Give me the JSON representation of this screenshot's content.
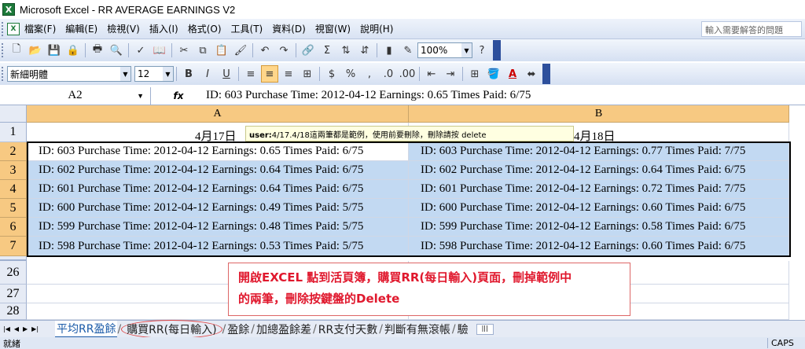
{
  "window": {
    "title": "Microsoft Excel - RR AVERAGE EARNINGS V2",
    "icon": "excel-icon"
  },
  "menu": {
    "items": [
      "檔案(F)",
      "編輯(E)",
      "檢視(V)",
      "插入(I)",
      "格式(O)",
      "工具(T)",
      "資料(D)",
      "視窗(W)",
      "說明(H)"
    ],
    "help_placeholder": "輸入需要解答的問題"
  },
  "toolbar": {
    "zoom": "100%",
    "font_name": "新細明體",
    "font_size": "12",
    "bold": "B",
    "italic": "I",
    "underline": "U",
    "currency": "$",
    "percent": "%"
  },
  "formula_bar": {
    "name_box": "A2",
    "fx": "fx",
    "formula": "ID: 603 Purchase Time: 2012-04-12 Earnings: 0.65 Times Paid: 6/75"
  },
  "sheet": {
    "columns": [
      "A",
      "B"
    ],
    "row_headers": [
      "1",
      "2",
      "3",
      "4",
      "5",
      "6",
      "7",
      "26",
      "27",
      "28"
    ],
    "header_row": {
      "a": "4月17日",
      "b": "4月18日"
    },
    "comment": {
      "author": "user:",
      "text": "4/17.4/18這兩筆都是範例，使用前要刪除，刪除請按 delete"
    },
    "rows": [
      {
        "a": "ID: 603 Purchase Time: 2012-04-12 Earnings: 0.65 Times Paid: 6/75",
        "b": "ID: 603 Purchase Time: 2012-04-12 Earnings: 0.77 Times Paid: 7/75"
      },
      {
        "a": "ID: 602 Purchase Time: 2012-04-12 Earnings: 0.64 Times Paid: 6/75",
        "b": "ID: 602 Purchase Time: 2012-04-12 Earnings: 0.64 Times Paid: 6/75"
      },
      {
        "a": "ID: 601 Purchase Time: 2012-04-12 Earnings: 0.64 Times Paid: 6/75",
        "b": "ID: 601 Purchase Time: 2012-04-12 Earnings: 0.72 Times Paid: 7/75"
      },
      {
        "a": "ID: 600 Purchase Time: 2012-04-12 Earnings: 0.49 Times Paid: 5/75",
        "b": "ID: 600 Purchase Time: 2012-04-12 Earnings: 0.60 Times Paid: 6/75"
      },
      {
        "a": "ID: 599 Purchase Time: 2012-04-12 Earnings: 0.48 Times Paid: 5/75",
        "b": "ID: 599 Purchase Time: 2012-04-12 Earnings: 0.58 Times Paid: 6/75"
      },
      {
        "a": "ID: 598 Purchase Time: 2012-04-12 Earnings: 0.53 Times Paid: 5/75",
        "b": "ID: 598 Purchase Time: 2012-04-12 Earnings: 0.60 Times Paid: 6/75"
      }
    ]
  },
  "annotation": {
    "line1": "開啟EXCEL 點到活頁簿，購買RR(每日輸入)頁面，刪掉範例中",
    "line2": "的兩筆，刪除按鍵盤的Delete"
  },
  "tabs": [
    "平均RR盈餘",
    "購買RR(每日輸入)",
    "盈餘",
    "加總盈餘差",
    "RR支付天數",
    "判斷有無滾帳",
    "驗"
  ],
  "status": {
    "ready": "就緒",
    "caps": "CAPS"
  },
  "colors": {
    "selection": "#c2d9f2",
    "header_selected": "#f7c982",
    "annotation": "#e0182d"
  }
}
